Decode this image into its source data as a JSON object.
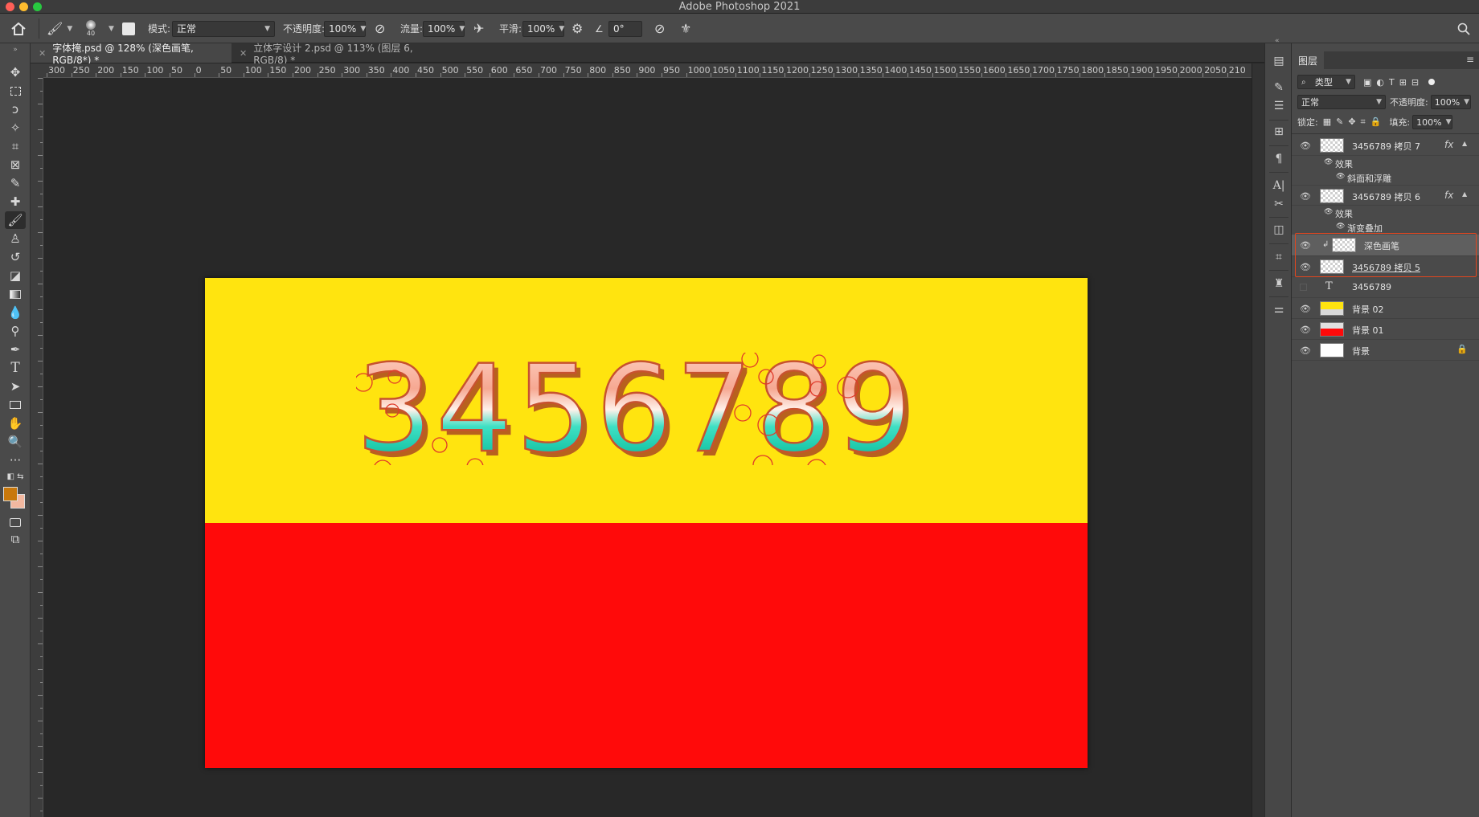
{
  "window": {
    "title": "Adobe Photoshop 2021"
  },
  "options_bar": {
    "brush_size": "40",
    "mode_label": "模式:",
    "mode_value": "正常",
    "opacity_label": "不透明度:",
    "opacity_value": "100%",
    "flow_label": "流量:",
    "flow_value": "100%",
    "smoothing_label": "平滑:",
    "smoothing_value": "100%",
    "angle_value": "0°"
  },
  "tabs": [
    {
      "label": "字体掩.psd @ 128% (深色画笔, RGB/8*) *",
      "active": true
    },
    {
      "label": "立体字设计 2.psd @ 113% (图层 6, RGB/8) *",
      "active": false
    }
  ],
  "ruler": {
    "h_labels": [
      "300",
      "250",
      "200",
      "150",
      "100",
      "50",
      "0",
      "50",
      "100",
      "150",
      "200",
      "250",
      "300",
      "350",
      "400",
      "450",
      "500",
      "550",
      "600",
      "650",
      "700",
      "750",
      "800",
      "850",
      "900",
      "950",
      "1000",
      "1050",
      "1100",
      "1150",
      "1200",
      "1250",
      "1300",
      "1350",
      "1400",
      "1450",
      "1500",
      "1550",
      "1600",
      "1650",
      "1700",
      "1750",
      "1800",
      "1850",
      "1900",
      "1950",
      "2000",
      "2050",
      "210"
    ]
  },
  "canvas": {
    "text": "3456789",
    "colors": {
      "top": "#ffe40f",
      "bottom": "#ff0a0a"
    }
  },
  "colors": {
    "foreground": "#c8780c",
    "background": "#f2b8a0"
  },
  "layers_panel": {
    "tab_label": "图层",
    "filter_kind": "类型",
    "blend_mode": "正常",
    "opacity_label": "不透明度:",
    "opacity_value": "100%",
    "lock_label": "锁定:",
    "fill_label": "填充:",
    "fill_value": "100%",
    "layers": [
      {
        "name": "3456789 拷贝 7",
        "fx": "fx",
        "effects_label": "效果",
        "effect": "斜面和浮雕"
      },
      {
        "name": "3456789 拷贝 6",
        "fx": "fx",
        "effects_label": "效果",
        "effect": "渐变叠加"
      },
      {
        "name": "深色画笔"
      },
      {
        "name": "3456789 拷贝 5"
      },
      {
        "name": "3456789"
      },
      {
        "name": "背景 02"
      },
      {
        "name": "背景 01"
      },
      {
        "name": "背景"
      }
    ]
  }
}
